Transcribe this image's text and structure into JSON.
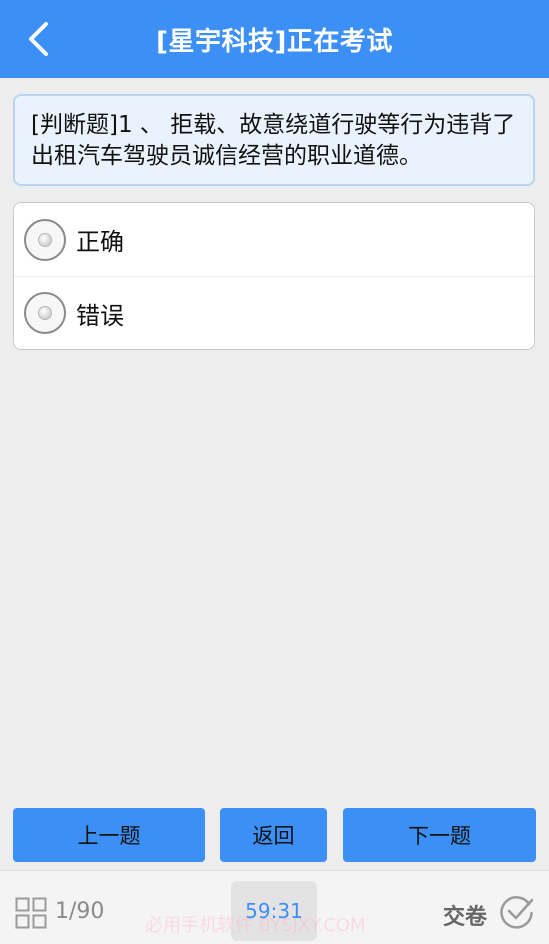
{
  "header": {
    "title": "[星宇科技]正在考试",
    "back_icon": "chevron-left-icon"
  },
  "question": {
    "text": "[判断题]1 、 拒载、故意绕道行驶等行为违背了出租汽车驾驶员诚信经营的职业道德。"
  },
  "options": [
    {
      "label": "正确",
      "selected": false
    },
    {
      "label": "错误",
      "selected": false
    }
  ],
  "nav": {
    "prev_label": "上一题",
    "return_label": "返回",
    "next_label": "下一题"
  },
  "footer": {
    "grid_icon": "grid-icon",
    "progress": "1/90",
    "timer": "59:31",
    "watermark": "必用手机软件 BYSJXY.COM",
    "submit_label": "交卷",
    "submit_icon": "check-circle-icon"
  },
  "colors": {
    "primary": "#3b8ff5",
    "background": "#ededed",
    "question_bg": "#eaf3fd"
  }
}
